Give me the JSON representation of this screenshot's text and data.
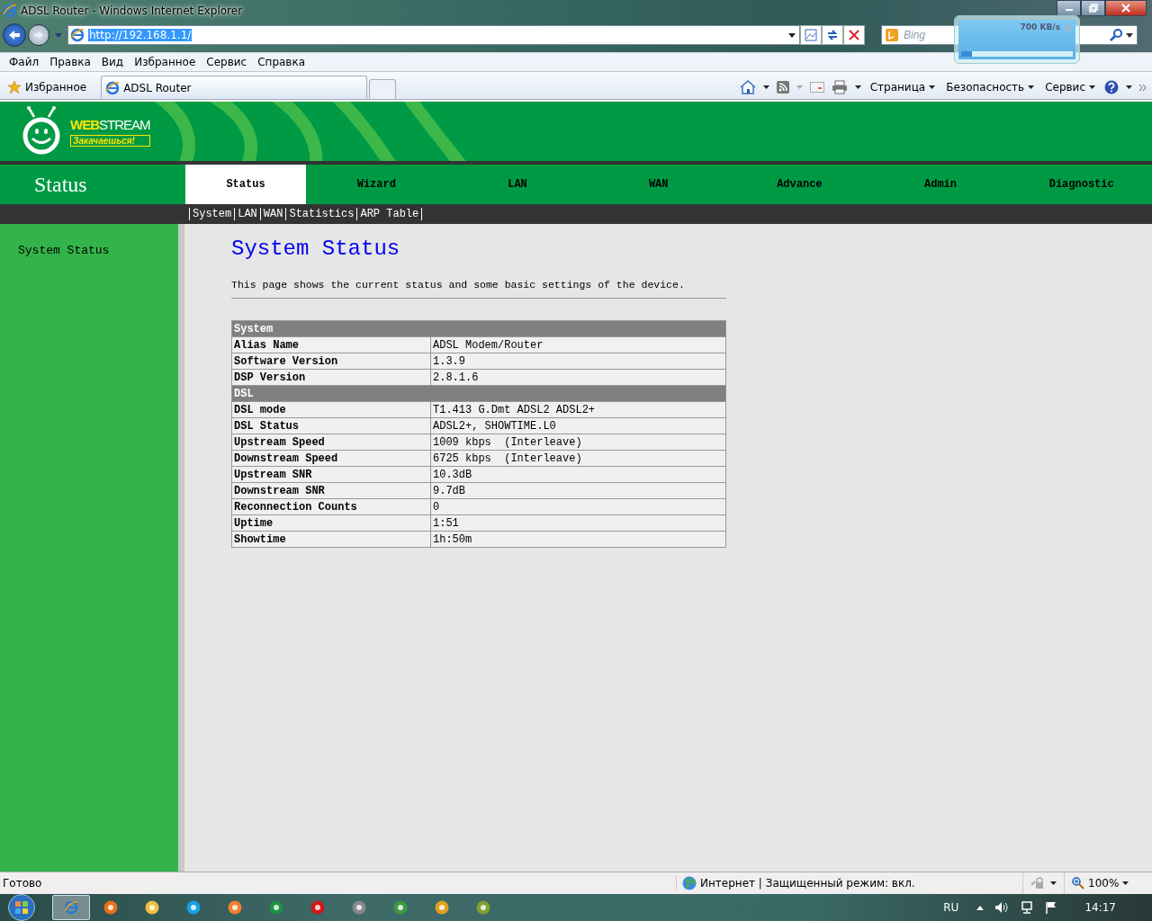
{
  "window": {
    "title": "ADSL Router - Windows Internet Explorer"
  },
  "address_bar": {
    "value": "http://192.168.1.1/"
  },
  "search": {
    "placeholder": "Bing"
  },
  "download_gadget": {
    "reading": "700 KB/s",
    "level": 0.1
  },
  "menu": [
    "Файл",
    "Правка",
    "Вид",
    "Избранное",
    "Сервис",
    "Справка"
  ],
  "favorites_button": "Избранное",
  "tabs": [
    {
      "label": "ADSL Router",
      "selected": true
    }
  ],
  "command_bar": [
    "Страница",
    "Безопасность",
    "Сервис"
  ],
  "router_page": {
    "logo": {
      "brand_first": "WEB",
      "brand_second": "STREAM",
      "slogan": "Закачаешься!"
    },
    "section_title": "Status",
    "nav": [
      {
        "label": "Status",
        "selected": true
      },
      {
        "label": "Wizard",
        "selected": false
      },
      {
        "label": "LAN",
        "selected": false
      },
      {
        "label": "WAN",
        "selected": false
      },
      {
        "label": "Advance",
        "selected": false
      },
      {
        "label": "Admin",
        "selected": false
      },
      {
        "label": "Diagnostic",
        "selected": false
      }
    ],
    "subnav": [
      "System",
      "LAN",
      "WAN",
      "Statistics",
      "ARP Table"
    ],
    "sidebar": [
      "System Status"
    ],
    "heading": "System Status",
    "description": "This page shows the current status and some basic settings of the device.",
    "table": [
      {
        "title": "System",
        "rows": [
          {
            "label": "Alias Name",
            "value": "ADSL Modem/Router"
          },
          {
            "label": "Software Version",
            "value": "1.3.9"
          },
          {
            "label": "DSP Version",
            "value": "2.8.1.6"
          }
        ]
      },
      {
        "title": "DSL",
        "rows": [
          {
            "label": "DSL mode",
            "value": "T1.413 G.Dmt ADSL2 ADSL2+"
          },
          {
            "label": "DSL Status",
            "value": "ADSL2+, SHOWTIME.L0"
          },
          {
            "label": "Upstream Speed",
            "value": "1009 kbps  (Interleave)"
          },
          {
            "label": "Downstream Speed",
            "value": "6725 kbps  (Interleave)"
          },
          {
            "label": "Upstream SNR",
            "value": "10.3dB"
          },
          {
            "label": "Downstream SNR",
            "value": "9.7dB"
          },
          {
            "label": "Reconnection Counts",
            "value": "0"
          },
          {
            "label": "Uptime",
            "value": "1:51"
          },
          {
            "label": "Showtime",
            "value": "1h:50m"
          }
        ]
      }
    ]
  },
  "status_bar": {
    "text": "Готово",
    "zone": "Интернет | Защищенный режим: вкл.",
    "zoom": "100%"
  },
  "taskbar": {
    "language": "RU",
    "clock": "14:17"
  }
}
